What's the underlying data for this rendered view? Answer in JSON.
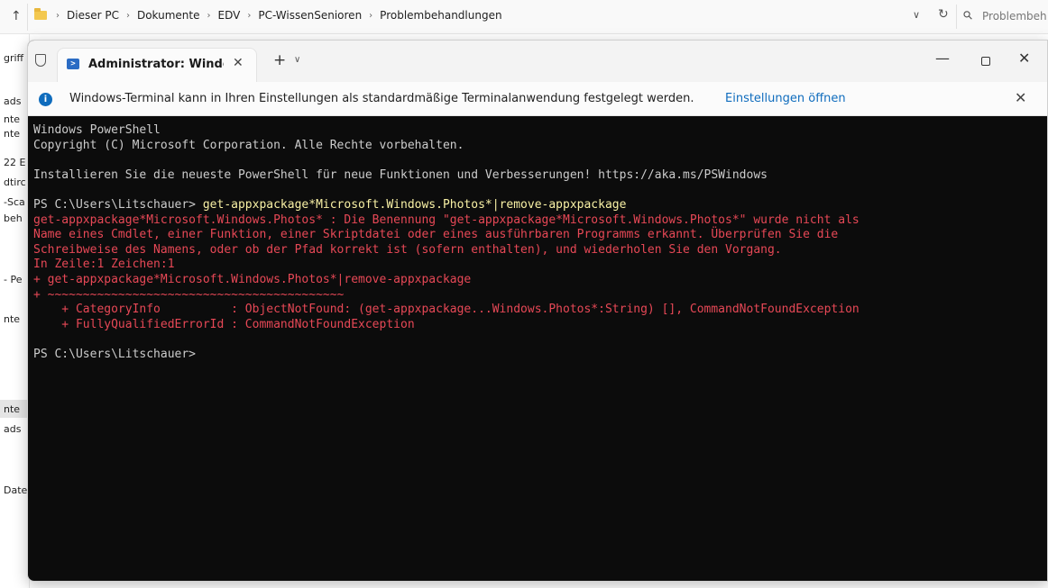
{
  "explorer": {
    "breadcrumb": [
      "Dieser PC",
      "Dokumente",
      "EDV",
      "PC-WissenSenioren",
      "Problembehandlungen"
    ],
    "search_placeholder": "Problembeh",
    "left_pane_items": [
      "griff",
      "ads",
      "nte",
      "nte",
      "22 E",
      "dtirc",
      "-Sca",
      "beh",
      "- Pe",
      "nte",
      "nte",
      "ads",
      "Date"
    ]
  },
  "terminal": {
    "tab_title": "Administrator: Windows I",
    "infobar_text": "Windows-Terminal kann in Ihren Einstellungen als standardmäßige Terminalanwendung festgelegt werden.",
    "infobar_link": "Einstellungen öffnen",
    "lines": [
      {
        "text": "Windows PowerShell",
        "style": "normal"
      },
      {
        "text": "Copyright (C) Microsoft Corporation. Alle Rechte vorbehalten.",
        "style": "normal"
      },
      {
        "text": "",
        "style": "normal"
      },
      {
        "text": "Installieren Sie die neueste PowerShell für neue Funktionen und Verbesserungen! https://aka.ms/PSWindows",
        "style": "normal"
      },
      {
        "text": "",
        "style": "normal"
      },
      {
        "prompt": "PS C:\\Users\\Litschauer> ",
        "text": "get-appxpackage*Microsoft.Windows.Photos*|remove-appxpackage",
        "style": "command"
      },
      {
        "text": "get-appxpackage*Microsoft.Windows.Photos* : Die Benennung \"get-appxpackage*Microsoft.Windows.Photos*\" wurde nicht als",
        "style": "error"
      },
      {
        "text": "Name eines Cmdlet, einer Funktion, einer Skriptdatei oder eines ausführbaren Programms erkannt. Überprüfen Sie die",
        "style": "error"
      },
      {
        "text": "Schreibweise des Namens, oder ob der Pfad korrekt ist (sofern enthalten), und wiederholen Sie den Vorgang.",
        "style": "error"
      },
      {
        "text": "In Zeile:1 Zeichen:1",
        "style": "error"
      },
      {
        "text": "+ get-appxpackage*Microsoft.Windows.Photos*|remove-appxpackage",
        "style": "error"
      },
      {
        "text": "+ ~~~~~~~~~~~~~~~~~~~~~~~~~~~~~~~~~~~~~~~~~~",
        "style": "error"
      },
      {
        "text": "    + CategoryInfo          : ObjectNotFound: (get-appxpackage...Windows.Photos*:String) [], CommandNotFoundException",
        "style": "error"
      },
      {
        "text": "    + FullyQualifiedErrorId : CommandNotFoundException",
        "style": "error"
      },
      {
        "text": "",
        "style": "normal"
      },
      {
        "text": "PS C:\\Users\\Litschauer>",
        "style": "normal"
      }
    ]
  },
  "colors": {
    "terminal_bg": "#0c0c0c",
    "terminal_fg": "#cccccc",
    "error_red": "#e74856",
    "command_yellow": "#f9f1a5",
    "link_blue": "#0f6cbd"
  }
}
